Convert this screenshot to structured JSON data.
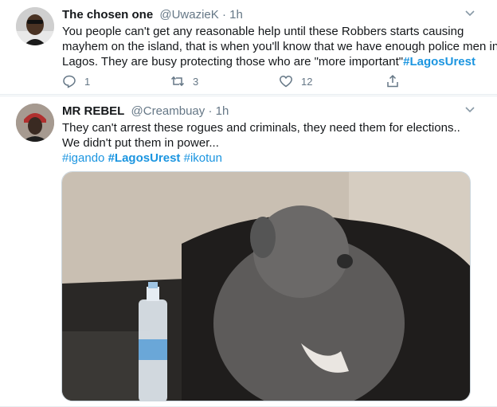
{
  "tweets": [
    {
      "name": "The chosen one",
      "handle": "@UwazieK",
      "dot": "·",
      "time": "1h",
      "lines": [
        "You people can't get any reasonable help until these Robbers starts causing",
        "mayhem on the island, that is when you'll know that we have enough police men in",
        "Lagos. They are busy protecting those who are \"more important\""
      ],
      "inline_hashtag": "#LagosUrest",
      "actions": {
        "reply_count": "1",
        "retweet_count": "3",
        "like_count": "12"
      }
    },
    {
      "name": "MR REBEL",
      "handle": "@Creambuay",
      "dot": "·",
      "time": "1h",
      "lines": [
        "They can't arrest these rogues and criminals,  they need them for elections..",
        "We didn't put them in power..."
      ],
      "hashtags": [
        "#igando",
        "#LagosUrest",
        "#ikotun"
      ],
      "image": "meme-dog-photo"
    }
  ],
  "icons": {
    "reply": "reply-icon",
    "retweet": "retweet-icon",
    "like": "heart-icon",
    "share": "share-icon",
    "caret": "chevron-down-icon"
  },
  "colors": {
    "accent": "#1b95e0",
    "muted": "#657786",
    "text": "#14171a",
    "border": "#e6ecf0"
  }
}
